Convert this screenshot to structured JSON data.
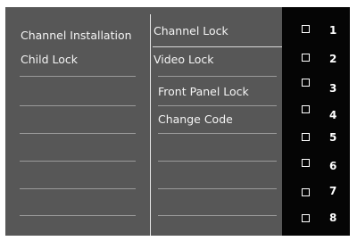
{
  "left_menu": {
    "items": [
      {
        "label": "Channel Installation"
      },
      {
        "label": "Child Lock"
      }
    ]
  },
  "sub_menu": {
    "items": [
      {
        "label": "Channel Lock"
      },
      {
        "label": "Video Lock"
      },
      {
        "label": "Front Panel Lock"
      },
      {
        "label": "Change Code"
      }
    ]
  },
  "channel_list": {
    "numbers": [
      "1",
      "2",
      "3",
      "4",
      "5",
      "6",
      "7",
      "8"
    ]
  }
}
